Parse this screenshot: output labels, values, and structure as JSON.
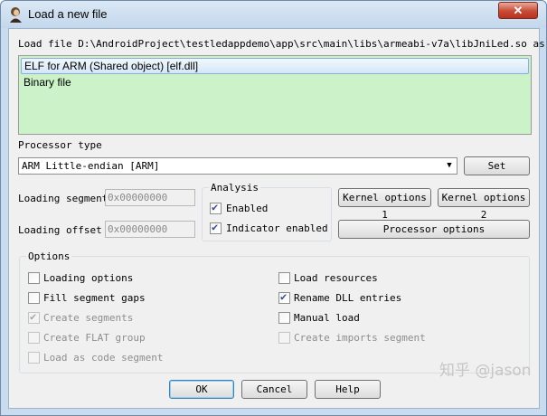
{
  "window": {
    "title": "Load a new file",
    "close_glyph": "✕"
  },
  "load_file_label": "Load file D:\\AndroidProject\\testledappdemo\\app\\src\\main\\libs\\armeabi-v7a\\libJniLed.so as",
  "file_types": [
    {
      "label": "ELF for ARM (Shared object) [elf.dll]",
      "selected": true
    },
    {
      "label": "Binary file",
      "selected": false
    }
  ],
  "processor": {
    "label": "Processor type",
    "selected": "ARM Little-endian [ARM]",
    "set_button": "Set"
  },
  "loading_segment": {
    "label": "Loading segment",
    "value": "0x00000000"
  },
  "loading_offset": {
    "label": "Loading offset",
    "value": "0x00000000"
  },
  "analysis": {
    "label": "Analysis",
    "enabled": {
      "label": "Enabled",
      "checked": true
    },
    "indicator": {
      "label": "Indicator enabled",
      "checked": true
    }
  },
  "buttons": {
    "kernel1": "Kernel options 1",
    "kernel2": "Kernel options 2",
    "processor_options": "Processor options",
    "ok": "OK",
    "cancel": "Cancel",
    "help": "Help"
  },
  "options": {
    "label": "Options",
    "left": [
      {
        "label": "Loading options",
        "checked": false,
        "disabled": false
      },
      {
        "label": "Fill segment gaps",
        "checked": false,
        "disabled": false
      },
      {
        "label": "Create segments",
        "checked": true,
        "disabled": true
      },
      {
        "label": "Create FLAT group",
        "checked": false,
        "disabled": true
      },
      {
        "label": "Load as code segment",
        "checked": false,
        "disabled": true
      }
    ],
    "right": [
      {
        "label": "Load resources",
        "checked": false,
        "disabled": false
      },
      {
        "label": "Rename DLL entries",
        "checked": true,
        "disabled": false
      },
      {
        "label": "Manual load",
        "checked": false,
        "disabled": false
      },
      {
        "label": "Create imports segment",
        "checked": false,
        "disabled": true
      }
    ]
  },
  "watermark": "知乎 @jason"
}
